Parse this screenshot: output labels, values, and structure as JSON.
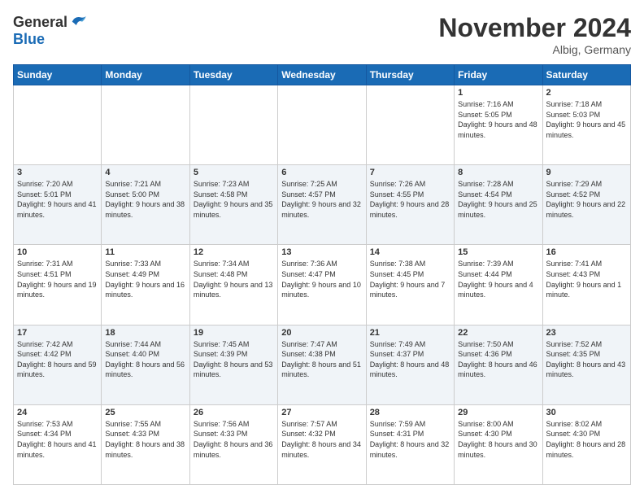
{
  "logo": {
    "general": "General",
    "blue": "Blue"
  },
  "header": {
    "month": "November 2024",
    "location": "Albig, Germany"
  },
  "weekdays": [
    "Sunday",
    "Monday",
    "Tuesday",
    "Wednesday",
    "Thursday",
    "Friday",
    "Saturday"
  ],
  "weeks": [
    [
      {
        "day": "",
        "info": ""
      },
      {
        "day": "",
        "info": ""
      },
      {
        "day": "",
        "info": ""
      },
      {
        "day": "",
        "info": ""
      },
      {
        "day": "",
        "info": ""
      },
      {
        "day": "1",
        "info": "Sunrise: 7:16 AM\nSunset: 5:05 PM\nDaylight: 9 hours and 48 minutes."
      },
      {
        "day": "2",
        "info": "Sunrise: 7:18 AM\nSunset: 5:03 PM\nDaylight: 9 hours and 45 minutes."
      }
    ],
    [
      {
        "day": "3",
        "info": "Sunrise: 7:20 AM\nSunset: 5:01 PM\nDaylight: 9 hours and 41 minutes."
      },
      {
        "day": "4",
        "info": "Sunrise: 7:21 AM\nSunset: 5:00 PM\nDaylight: 9 hours and 38 minutes."
      },
      {
        "day": "5",
        "info": "Sunrise: 7:23 AM\nSunset: 4:58 PM\nDaylight: 9 hours and 35 minutes."
      },
      {
        "day": "6",
        "info": "Sunrise: 7:25 AM\nSunset: 4:57 PM\nDaylight: 9 hours and 32 minutes."
      },
      {
        "day": "7",
        "info": "Sunrise: 7:26 AM\nSunset: 4:55 PM\nDaylight: 9 hours and 28 minutes."
      },
      {
        "day": "8",
        "info": "Sunrise: 7:28 AM\nSunset: 4:54 PM\nDaylight: 9 hours and 25 minutes."
      },
      {
        "day": "9",
        "info": "Sunrise: 7:29 AM\nSunset: 4:52 PM\nDaylight: 9 hours and 22 minutes."
      }
    ],
    [
      {
        "day": "10",
        "info": "Sunrise: 7:31 AM\nSunset: 4:51 PM\nDaylight: 9 hours and 19 minutes."
      },
      {
        "day": "11",
        "info": "Sunrise: 7:33 AM\nSunset: 4:49 PM\nDaylight: 9 hours and 16 minutes."
      },
      {
        "day": "12",
        "info": "Sunrise: 7:34 AM\nSunset: 4:48 PM\nDaylight: 9 hours and 13 minutes."
      },
      {
        "day": "13",
        "info": "Sunrise: 7:36 AM\nSunset: 4:47 PM\nDaylight: 9 hours and 10 minutes."
      },
      {
        "day": "14",
        "info": "Sunrise: 7:38 AM\nSunset: 4:45 PM\nDaylight: 9 hours and 7 minutes."
      },
      {
        "day": "15",
        "info": "Sunrise: 7:39 AM\nSunset: 4:44 PM\nDaylight: 9 hours and 4 minutes."
      },
      {
        "day": "16",
        "info": "Sunrise: 7:41 AM\nSunset: 4:43 PM\nDaylight: 9 hours and 1 minute."
      }
    ],
    [
      {
        "day": "17",
        "info": "Sunrise: 7:42 AM\nSunset: 4:42 PM\nDaylight: 8 hours and 59 minutes."
      },
      {
        "day": "18",
        "info": "Sunrise: 7:44 AM\nSunset: 4:40 PM\nDaylight: 8 hours and 56 minutes."
      },
      {
        "day": "19",
        "info": "Sunrise: 7:45 AM\nSunset: 4:39 PM\nDaylight: 8 hours and 53 minutes."
      },
      {
        "day": "20",
        "info": "Sunrise: 7:47 AM\nSunset: 4:38 PM\nDaylight: 8 hours and 51 minutes."
      },
      {
        "day": "21",
        "info": "Sunrise: 7:49 AM\nSunset: 4:37 PM\nDaylight: 8 hours and 48 minutes."
      },
      {
        "day": "22",
        "info": "Sunrise: 7:50 AM\nSunset: 4:36 PM\nDaylight: 8 hours and 46 minutes."
      },
      {
        "day": "23",
        "info": "Sunrise: 7:52 AM\nSunset: 4:35 PM\nDaylight: 8 hours and 43 minutes."
      }
    ],
    [
      {
        "day": "24",
        "info": "Sunrise: 7:53 AM\nSunset: 4:34 PM\nDaylight: 8 hours and 41 minutes."
      },
      {
        "day": "25",
        "info": "Sunrise: 7:55 AM\nSunset: 4:33 PM\nDaylight: 8 hours and 38 minutes."
      },
      {
        "day": "26",
        "info": "Sunrise: 7:56 AM\nSunset: 4:33 PM\nDaylight: 8 hours and 36 minutes."
      },
      {
        "day": "27",
        "info": "Sunrise: 7:57 AM\nSunset: 4:32 PM\nDaylight: 8 hours and 34 minutes."
      },
      {
        "day": "28",
        "info": "Sunrise: 7:59 AM\nSunset: 4:31 PM\nDaylight: 8 hours and 32 minutes."
      },
      {
        "day": "29",
        "info": "Sunrise: 8:00 AM\nSunset: 4:30 PM\nDaylight: 8 hours and 30 minutes."
      },
      {
        "day": "30",
        "info": "Sunrise: 8:02 AM\nSunset: 4:30 PM\nDaylight: 8 hours and 28 minutes."
      }
    ]
  ]
}
